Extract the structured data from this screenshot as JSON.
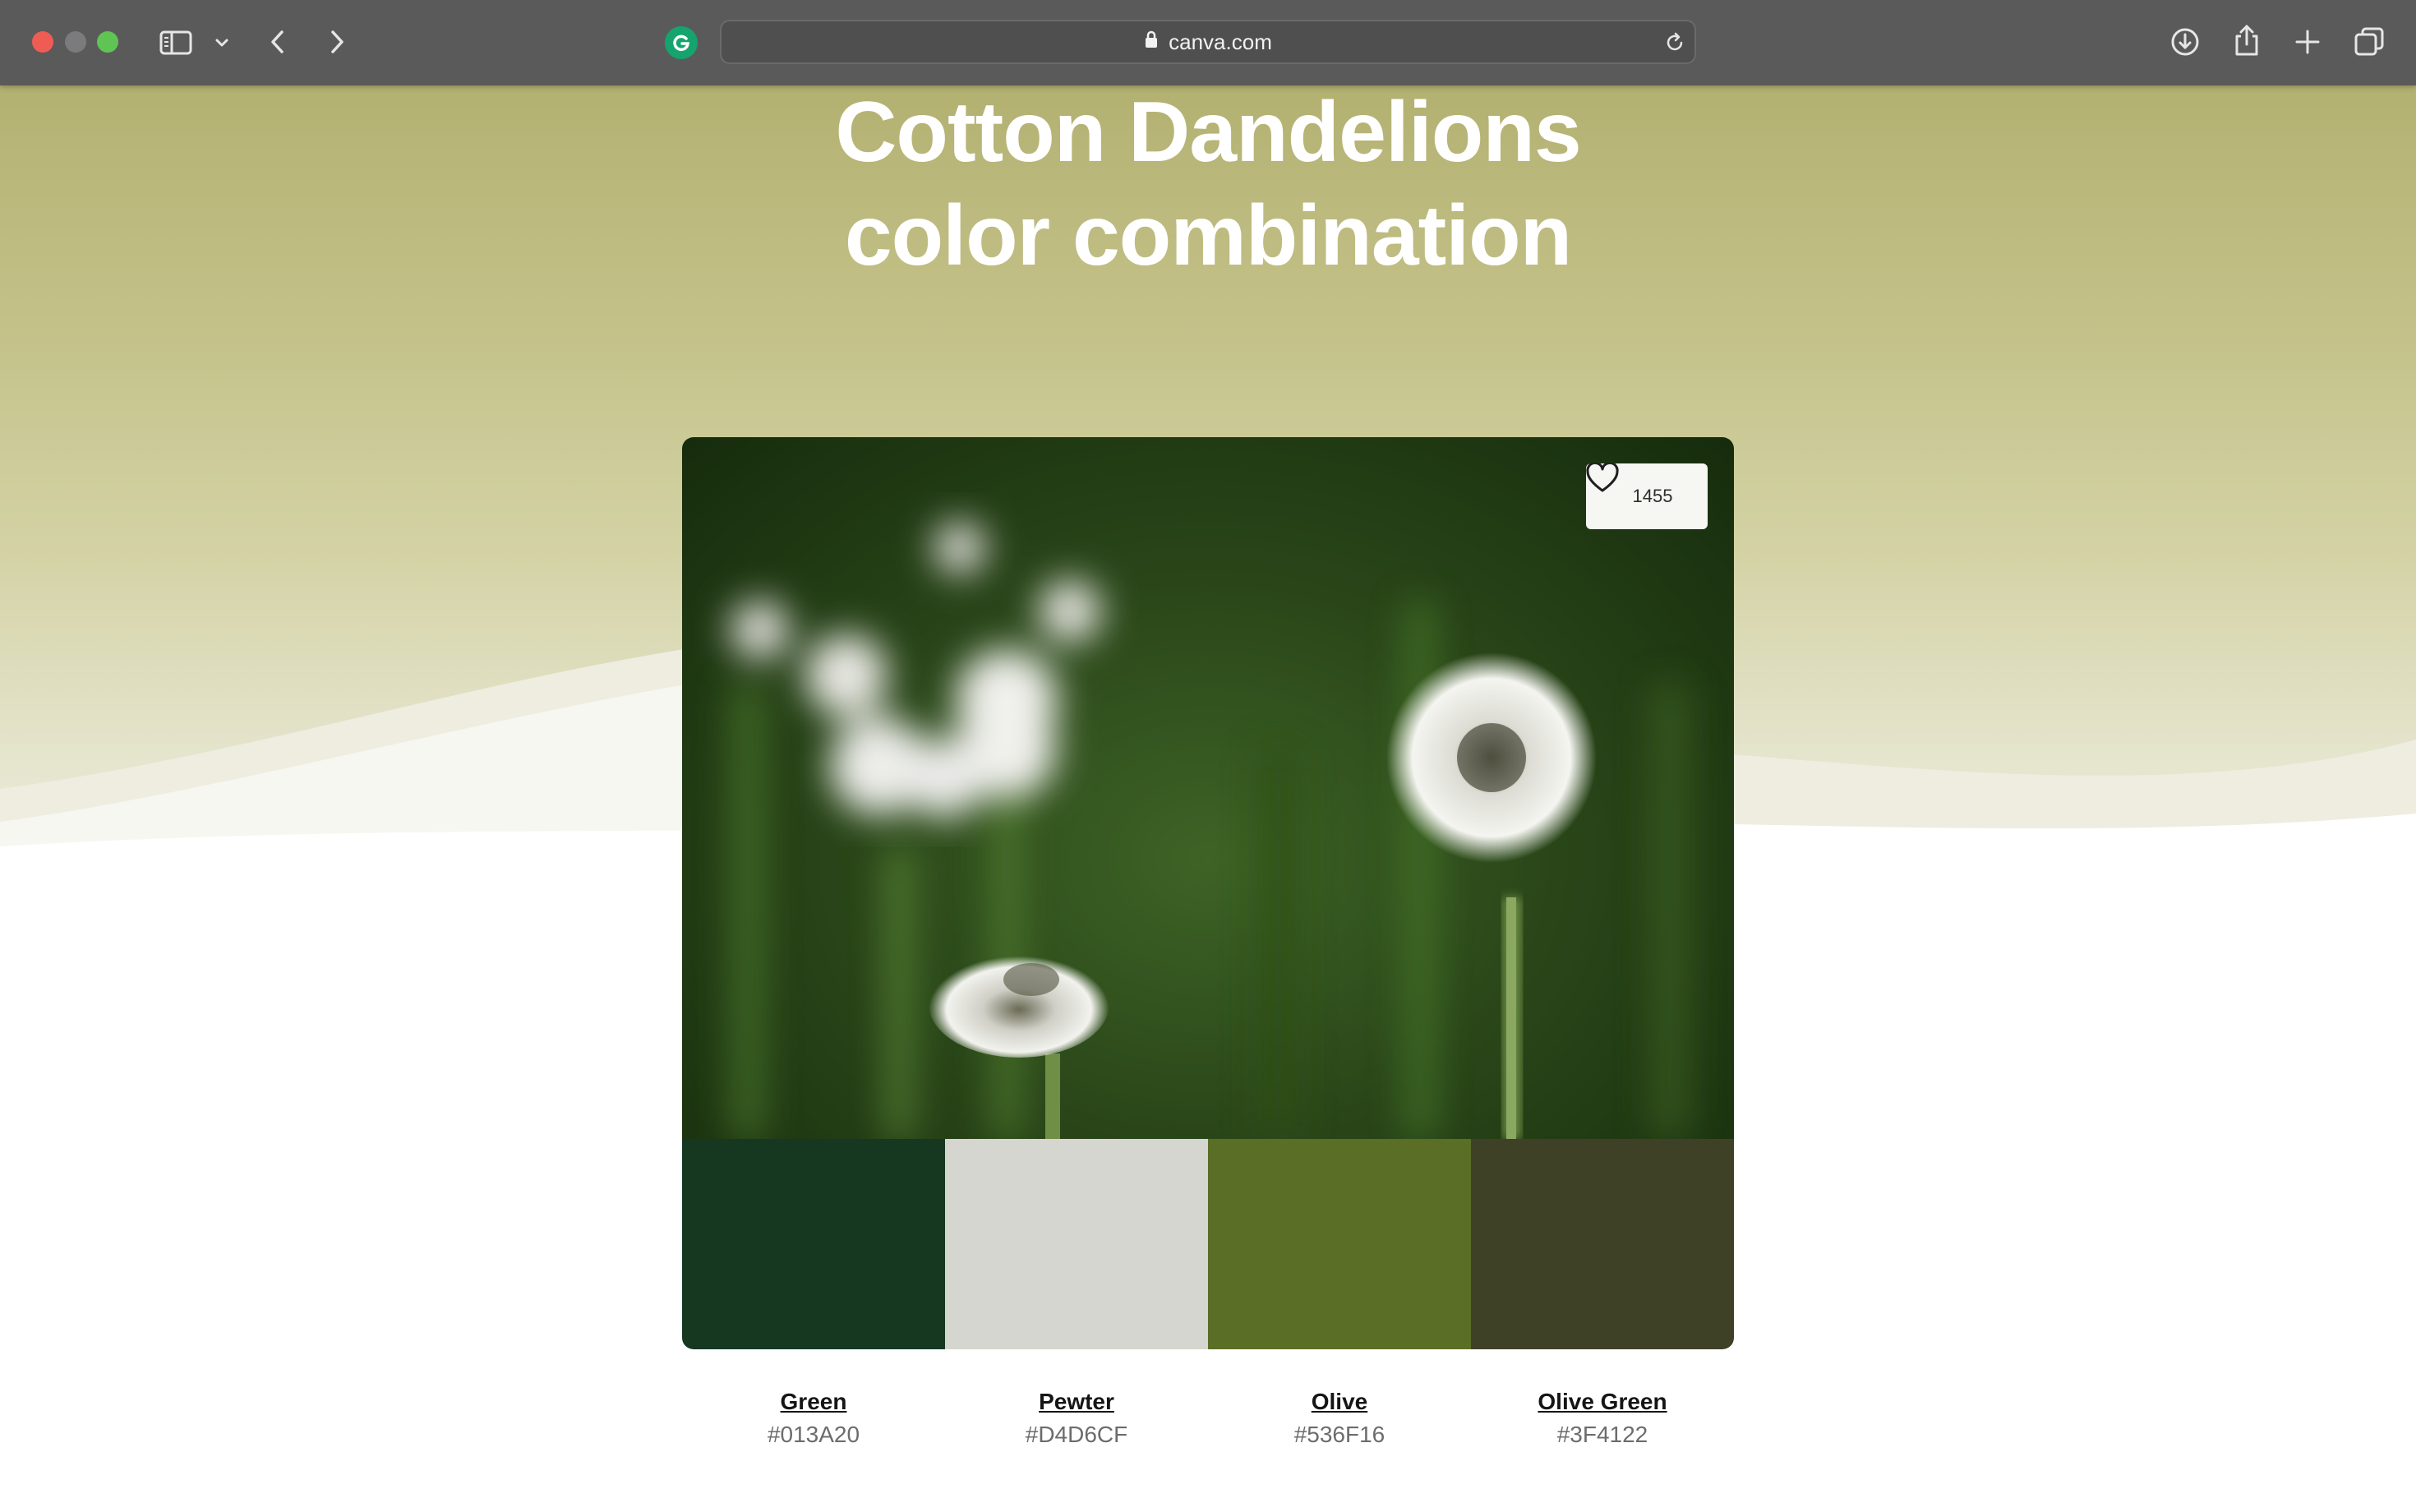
{
  "browser": {
    "url": "canva.com",
    "icons": [
      "sidebar-icon",
      "chevron-down-icon",
      "back-icon",
      "forward-icon",
      "grammarly-icon",
      "lock-icon",
      "reload-icon",
      "download-icon",
      "share-icon",
      "new-tab-icon",
      "tabs-overview-icon"
    ]
  },
  "hero": {
    "title_line1": "Cotton Dandelions",
    "title_line2": "color combination"
  },
  "card": {
    "likes": "1455",
    "like_icon": "heart-icon"
  },
  "palette": [
    {
      "name": "Green",
      "hex": "#013A20",
      "display": "#163821"
    },
    {
      "name": "Pewter",
      "hex": "#D4D6CF",
      "display": "#D4D6CF"
    },
    {
      "name": "Olive",
      "hex": "#536F16",
      "display": "#5B6E26"
    },
    {
      "name": "Olive Green",
      "hex": "#3F4122",
      "display": "#3F4126"
    }
  ]
}
